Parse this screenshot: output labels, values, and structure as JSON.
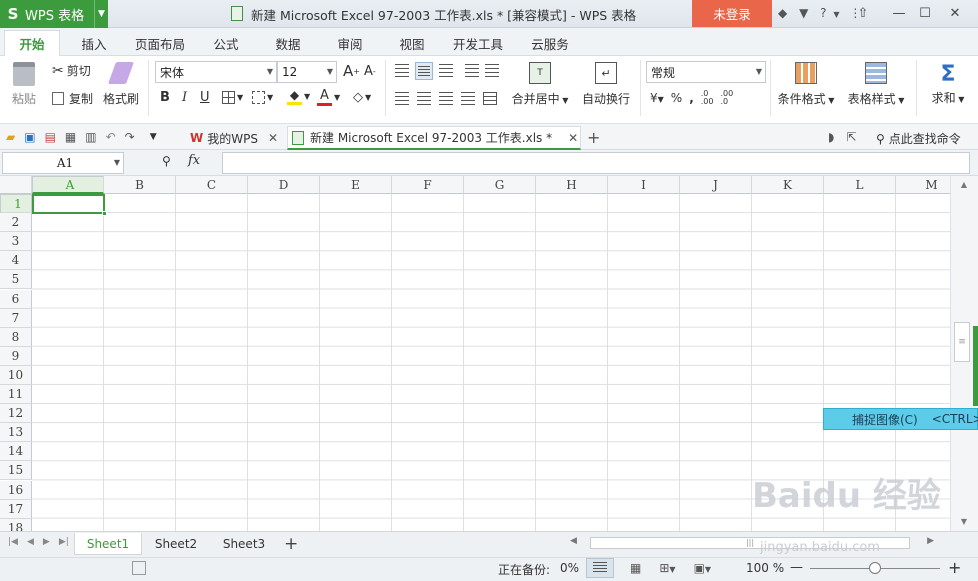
{
  "app": {
    "logo_letter": "S",
    "name": "WPS 表格",
    "title": "新建 Microsoft Excel 97-2003 工作表.xls * [兼容模式] - WPS 表格",
    "login": "未登录"
  },
  "menu": [
    "开始",
    "插入",
    "页面布局",
    "公式",
    "数据",
    "审阅",
    "视图",
    "开发工具",
    "云服务"
  ],
  "ribbon": {
    "paste": "粘贴",
    "cut": "剪切",
    "copy": "复制",
    "format_painter": "格式刷",
    "font_name": "宋体",
    "font_size": "12",
    "merge_center": "合并居中",
    "wrap_text": "自动换行",
    "number_format": "常规",
    "percent": "%",
    "comma": ",",
    "cond_format": "条件格式",
    "table_style": "表格样式",
    "sum": "求和"
  },
  "doc_tabs": {
    "home": "我的WPS",
    "file": "新建 Microsoft Excel 97-2003 工作表.xls *",
    "search": "点此查找命令"
  },
  "formula": {
    "cell_ref": "A1",
    "fx": "fx",
    "value": ""
  },
  "columns": [
    "A",
    "B",
    "C",
    "D",
    "E",
    "F",
    "G",
    "H",
    "I",
    "J",
    "K",
    "L",
    "M"
  ],
  "rows": [
    "1",
    "2",
    "3",
    "4",
    "5",
    "6",
    "7",
    "8",
    "9",
    "10",
    "11",
    "12",
    "13",
    "14",
    "15",
    "16",
    "17",
    "18"
  ],
  "selected_cell": "A1",
  "sheets": [
    "Sheet1",
    "Sheet2",
    "Sheet3"
  ],
  "active_sheet": "Sheet1",
  "status": {
    "backup": "正在备份:",
    "backup_pct": "0%",
    "zoom": "100 %",
    "zoom_level": 0.5
  },
  "capture_popup": {
    "label": "捕捉图像(C)",
    "shortcut": "<CTRL>"
  },
  "watermark": {
    "brand": "Baidu 经验",
    "url": "jingyan.baidu.com"
  },
  "colors": {
    "accent": "#3c9b3c",
    "login": "#e9664a",
    "capture": "#5ccce8"
  }
}
